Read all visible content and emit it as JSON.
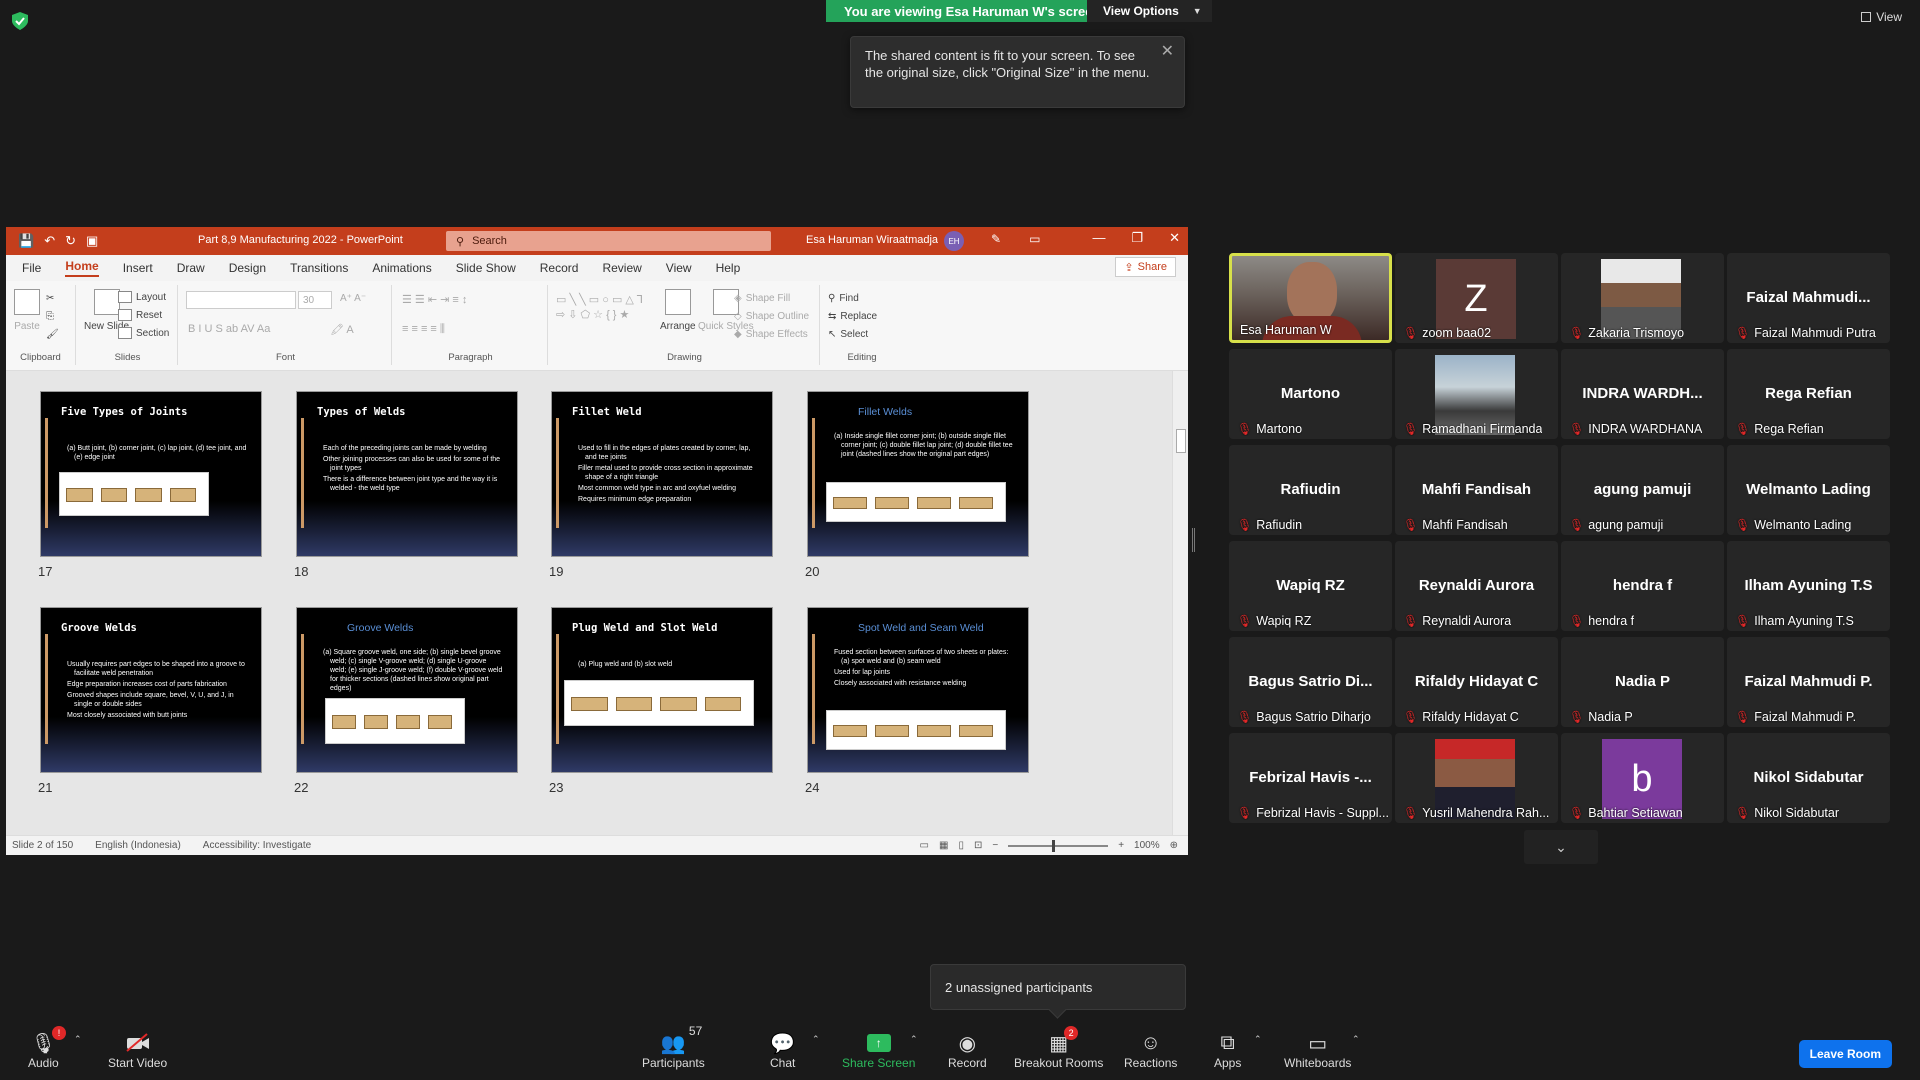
{
  "top": {
    "viewing_text": "You are viewing Esa Haruman W's screen",
    "view_options": "View Options",
    "tooltip": "The shared content is fit to your screen. To see the original size, click \"Original Size\" in the menu.",
    "view_label": "View"
  },
  "ppt": {
    "doc_title": "Part 8,9 Manufacturing 2022  -  PowerPoint",
    "search_placeholder": "Search",
    "user_name": "Esa Haruman Wiraatmadja",
    "user_initials": "EH",
    "tabs": [
      "File",
      "Home",
      "Insert",
      "Draw",
      "Design",
      "Transitions",
      "Animations",
      "Slide Show",
      "Record",
      "Review",
      "View",
      "Help"
    ],
    "share": "Share",
    "groups": {
      "clipboard": "Clipboard",
      "slides": "Slides",
      "font": "Font",
      "paragraph": "Paragraph",
      "drawing": "Drawing",
      "editing": "Editing"
    },
    "ribbon": {
      "paste": "Paste",
      "new_slide": "New Slide",
      "layout": "Layout",
      "reset": "Reset",
      "section": "Section",
      "font_size": "30",
      "arrange": "Arrange",
      "quick_styles": "Quick Styles",
      "shape_fill": "Shape Fill",
      "shape_outline": "Shape Outline",
      "shape_effects": "Shape Effects",
      "find": "Find",
      "replace": "Replace",
      "select": "Select"
    },
    "slides": [
      {
        "num": "17",
        "title": "Five Types of Joints",
        "style": "mono",
        "lines": [
          "(a) Butt joint, (b) corner joint, (c) lap joint, (d) tee joint, and (e) edge joint"
        ]
      },
      {
        "num": "18",
        "title": "Types of Welds",
        "style": "mono",
        "lines": [
          "Each of the preceding joints can be made by welding",
          "Other joining processes can also be used for some of the joint types",
          "There is a difference between joint type and the way it is welded - the weld type"
        ]
      },
      {
        "num": "19",
        "title": "Fillet Weld",
        "style": "mono",
        "lines": [
          "Used to fill in the edges of plates created by corner, lap, and tee joints",
          "Filler metal used to provide cross section in approximate shape of a right triangle",
          "Most common weld type in arc and oxyfuel welding",
          "Requires minimum edge preparation"
        ]
      },
      {
        "num": "20",
        "title": "Fillet Welds",
        "style": "blue",
        "lines": [
          "(a) Inside single fillet corner joint; (b) outside single fillet corner joint; (c) double fillet lap joint; (d) double fillet tee joint (dashed lines show the original part edges)"
        ]
      },
      {
        "num": "21",
        "title": "Groove Welds",
        "style": "mono",
        "lines": [
          "Usually requires part edges to be shaped into a groove to facilitate weld penetration",
          "Edge preparation increases cost of parts fabrication",
          "Grooved shapes include square, bevel, V, U, and J, in single or double sides",
          "Most closely associated with butt joints"
        ]
      },
      {
        "num": "22",
        "title": "Groove Welds",
        "style": "blue",
        "lines": [
          "(a) Square groove weld, one side; (b) single bevel groove weld; (c) single V-groove weld; (d) single U-groove weld; (e) single J-groove weld; (f) double V-groove weld for thicker sections (dashed lines show original part edges)"
        ]
      },
      {
        "num": "23",
        "title": "Plug Weld and Slot Weld",
        "style": "mono",
        "lines": [
          "(a) Plug weld and (b) slot weld"
        ]
      },
      {
        "num": "24",
        "title": "Spot Weld and Seam Weld",
        "style": "blue",
        "lines": [
          "Fused section between surfaces of two sheets or plates: (a) spot weld and (b) seam weld",
          "Used for lap joints",
          "Closely associated with resistance welding"
        ]
      }
    ],
    "status": {
      "slide": "Slide 2 of 150",
      "language": "English (Indonesia)",
      "accessibility": "Accessibility: Investigate",
      "zoom": "100%"
    }
  },
  "participants": [
    {
      "display": "",
      "label": "Esa Haruman W",
      "type": "video",
      "active": true,
      "muted": false
    },
    {
      "display": "Z",
      "label": "zoom baa02",
      "type": "letter",
      "color": "#5a3a36",
      "muted": true
    },
    {
      "display": "",
      "label": "Zakaria Trismoyo",
      "type": "photo",
      "muted": true
    },
    {
      "display": "Faizal  Mahmudi...",
      "label": "Faizal Mahmudi Putra",
      "type": "name",
      "muted": true
    },
    {
      "display": "Martono",
      "label": "Martono",
      "type": "name",
      "muted": true
    },
    {
      "display": "",
      "label": "Ramadhani Firmanda",
      "type": "photo2",
      "muted": true
    },
    {
      "display": "INDRA  WARDH...",
      "label": "INDRA WARDHANA",
      "type": "name",
      "muted": true
    },
    {
      "display": "Rega Refian",
      "label": "Rega Refian",
      "type": "name",
      "muted": true
    },
    {
      "display": "Rafiudin",
      "label": "Rafiudin",
      "type": "name",
      "muted": true
    },
    {
      "display": "Mahfi Fandisah",
      "label": "Mahfi Fandisah",
      "type": "name",
      "muted": true
    },
    {
      "display": "agung pamuji",
      "label": "agung pamuji",
      "type": "name",
      "muted": true
    },
    {
      "display": "Welmanto Lading",
      "label": "Welmanto Lading",
      "type": "name",
      "muted": true
    },
    {
      "display": "Wapiq RZ",
      "label": "Wapiq RZ",
      "type": "name",
      "muted": true
    },
    {
      "display": "Reynaldi Aurora",
      "label": "Reynaldi Aurora",
      "type": "name",
      "muted": true
    },
    {
      "display": "hendra f",
      "label": "hendra f",
      "type": "name",
      "muted": true
    },
    {
      "display": "Ilham Ayuning T.S",
      "label": "Ilham Ayuning T.S",
      "type": "name",
      "muted": true
    },
    {
      "display": "Bagus Satrio Di...",
      "label": "Bagus Satrio Diharjo",
      "type": "name",
      "muted": true
    },
    {
      "display": "Rifaldy Hidayat C",
      "label": "Rifaldy Hidayat C",
      "type": "name",
      "muted": true
    },
    {
      "display": "Nadia P",
      "label": "Nadia P",
      "type": "name",
      "muted": true
    },
    {
      "display": "Faizal Mahmudi P.",
      "label": "Faizal Mahmudi P.",
      "type": "name",
      "muted": true
    },
    {
      "display": "Febrizal  Havis  -...",
      "label": "Febrizal Havis - Suppl...",
      "type": "name",
      "muted": true
    },
    {
      "display": "",
      "label": "Yusril Mahendra Rah...",
      "type": "photo3",
      "muted": true
    },
    {
      "display": "b",
      "label": "Bahtiar Setiawan",
      "type": "letter",
      "color": "#7b3a9c",
      "muted": true
    },
    {
      "display": "Nikol Sidabutar",
      "label": "Nikol Sidabutar",
      "type": "name",
      "muted": true
    }
  ],
  "unassigned": "2 unassigned participants",
  "toolbar": {
    "audio": "Audio",
    "audio_badge": "!",
    "video": "Start Video",
    "participants": "Participants",
    "participants_count": "57",
    "chat": "Chat",
    "share": "Share Screen",
    "record": "Record",
    "breakout": "Breakout Rooms",
    "breakout_badge": "2",
    "reactions": "Reactions",
    "apps": "Apps",
    "whiteboards": "Whiteboards",
    "leave": "Leave Room"
  }
}
